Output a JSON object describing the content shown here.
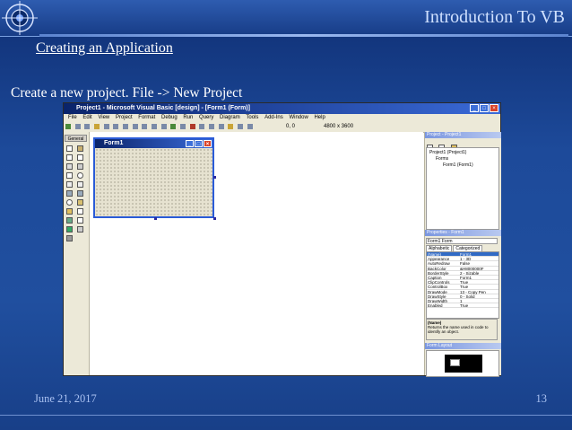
{
  "slide": {
    "header_title": "Introduction To VB",
    "subtitle": "Creating an Application",
    "body_text": "Create a new project. File -> New Project",
    "footer_date": "June 21, 2017",
    "page_number": "13"
  },
  "vb": {
    "window_title": "Project1 - Microsoft Visual Basic [design] - [Form1 (Form)]",
    "menu": [
      "File",
      "Edit",
      "View",
      "Project",
      "Format",
      "Debug",
      "Run",
      "Query",
      "Diagram",
      "Tools",
      "Add-Ins",
      "Window",
      "Help"
    ],
    "toolbar": {
      "position": "0, 0",
      "size": "4800 x 3600"
    },
    "toolbox_label": "General",
    "form_title": "Form1",
    "project_panel_title": "Project - Project1",
    "project_tree": [
      "Project1 (Project1)",
      "Forms",
      "Form1 (Form1)"
    ],
    "properties_panel_title": "Properties - Form1",
    "properties_object": "Form1  Form",
    "properties_tabs": [
      "Alphabetic",
      "Categorized"
    ],
    "properties": [
      {
        "name": "(Name)",
        "value": "Form1"
      },
      {
        "name": "Appearance",
        "value": "1 - 3D"
      },
      {
        "name": "AutoRedraw",
        "value": "False"
      },
      {
        "name": "BackColor",
        "value": "&H8000000F"
      },
      {
        "name": "BorderStyle",
        "value": "2 - Sizable"
      },
      {
        "name": "Caption",
        "value": "Form1"
      },
      {
        "name": "ClipControls",
        "value": "True"
      },
      {
        "name": "ControlBox",
        "value": "True"
      },
      {
        "name": "DrawMode",
        "value": "13 - Copy Pen"
      },
      {
        "name": "DrawStyle",
        "value": "0 - Solid"
      },
      {
        "name": "DrawWidth",
        "value": "1"
      },
      {
        "name": "Enabled",
        "value": "True"
      }
    ],
    "prop_desc_title": "(Name)",
    "prop_desc_text": "Returns the name used in code to identify an object.",
    "layout_panel_title": "Form Layout"
  },
  "colors": {
    "slide_bg": "#1d4a9a",
    "vb_title": "#0a246a",
    "form_border": "#2a5bd7"
  }
}
